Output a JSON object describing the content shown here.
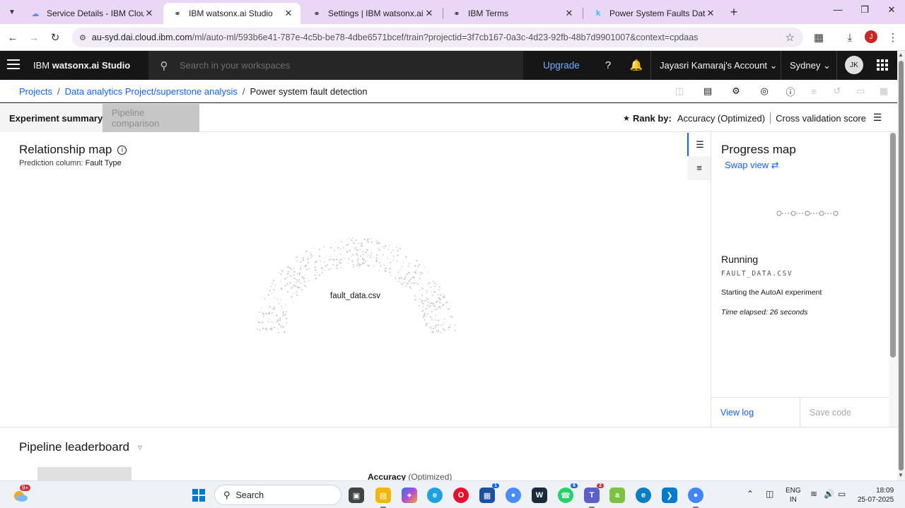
{
  "browser": {
    "tabs": [
      {
        "title": "Service Details - IBM Cloud",
        "icon": "cloud-icon",
        "active": false
      },
      {
        "title": "IBM watsonx.ai Studio",
        "icon": "watsonx-icon",
        "active": true
      },
      {
        "title": "Settings | IBM watsonx.ai Studio",
        "icon": "watsonx-icon",
        "active": false
      },
      {
        "title": "IBM Terms",
        "icon": "watsonx-icon",
        "active": false
      },
      {
        "title": "Power System Faults Dataset",
        "icon": "kaggle-icon",
        "active": false
      }
    ],
    "url_host": "au-syd.dai.cloud.ibm.com",
    "url_path": "/ml/auto-ml/593b6e41-787e-4c5b-be78-4dbe6571bcef/train?projectid=3f7cb167-0a3c-4d23-92fb-48b7d9901007&context=cpdaas",
    "profile_initial": "J"
  },
  "header": {
    "brand_prefix": "IBM ",
    "brand_name": "watsonx.ai Studio",
    "search_placeholder": "Search in your workspaces",
    "upgrade_label": "Upgrade",
    "account_label": "Jayasri Kamaraj's Account",
    "region_label": "Sydney",
    "avatar_initials": "JK"
  },
  "breadcrumb": {
    "items": [
      "Projects",
      "Data analytics Project/superstone analysis",
      "Power system fault detection"
    ],
    "separator": "/"
  },
  "tabs": {
    "summary": "Experiment summary",
    "comparison": "Pipeline comparison"
  },
  "rank": {
    "label": "Rank by:",
    "metric": "Accuracy (Optimized)",
    "secondary": "Cross validation score"
  },
  "relationship_map": {
    "title": "Relationship map",
    "prediction_label": "Prediction column:",
    "prediction_value": "Fault Type",
    "center_label": "fault_data.csv"
  },
  "progress_map": {
    "title": "Progress map",
    "swap_label": "Swap view",
    "status": "Running",
    "file_name": "FAULT_DATA.CSV",
    "message": "Starting the AutoAI experiment",
    "elapsed": "Time elapsed: 26 seconds",
    "view_log_label": "View log",
    "save_code_label": "Save code"
  },
  "leaderboard": {
    "title": "Pipeline leaderboard",
    "column_metric": "Accuracy",
    "column_qualifier": "(Optimized)"
  },
  "taskbar": {
    "search_label": "Search",
    "weather_badge": "9+",
    "teams_badge": "2",
    "whatsapp_badge": "6",
    "store_badge": "1",
    "lang_line1": "ENG",
    "lang_line2": "IN",
    "time": "18:09",
    "date": "25-07-2025"
  },
  "colors": {
    "accent_blue": "#0f62fe",
    "header_bg": "#161616",
    "tab_strip_bg": "#e9d7f5"
  }
}
